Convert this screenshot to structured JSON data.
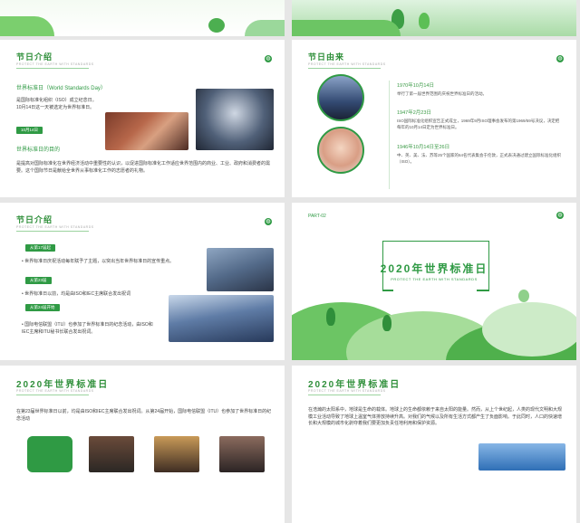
{
  "slides": {
    "intro": {
      "title": "节日介绍",
      "subtitle": "PROTECT THE EARTH WITH STANDARDS",
      "heading": "世界标准日（World Standards Day）",
      "body1": "是国际标准化组织（ISO）成立纪念日。10月14日这一天被选定为世界标准日。",
      "tag": "10月14日",
      "purpose": "世界标准日的目的",
      "body2": "是提高对国际标准化在世界经济活动中重要性的认识，以促进国际标准化工作适应世界范围内的商业、工业、政府和消费者的需要。这个国际节日是献给全世界从事标准化工作的志愿者的礼物。"
    },
    "origin": {
      "title": "节日由来",
      "subtitle": "PROTECT THE EARTH WITH STANDARDS",
      "items": [
        {
          "date": "1970年10月14日",
          "text": "举行了第一届世界范围的庆祝世界标准日的活动。"
        },
        {
          "date": "1947年2月23日",
          "text": "ISO国际标准化组织宣告正式成立，1969年9月ISO理事会发布的第1969/59号决议，决定把每年的10月14日定为世界标准日。"
        },
        {
          "date": "1946年10月14日至26日",
          "text": "中、英、美、法、苏等25个国家的64名代表集会于伦敦，正式表决通过建立国际标准化组织（ISO）。"
        }
      ]
    },
    "intro2": {
      "title": "节日介绍",
      "subtitle": "PROTECT THE EARTH WITH STANDARDS",
      "tag1": "从第17届起",
      "text1": "世界标准日庆祝活动每年赋予了主题，以突出当年世界标准日的宣传重点。",
      "tag2": "从第23届",
      "text2": "世界标准日以前，均是由ISO和IEC主席联合发出祝词",
      "tag3": "从第24届开始",
      "text3": "国际电信联盟（ITU）也参加了世界标准日的纪念活动，由ISO和IEC主席和ITU秘书长联合发出祝词。"
    },
    "part": {
      "label": "PART-02",
      "title": "2020年世界标准日",
      "sub": "PROTECT THE EARTH WITH STANDARDS"
    },
    "event1": {
      "title": "2020年世界标准日",
      "subtitle": "PROTECT THE EARTH WITH STANDARDS",
      "body": "在第23届世界标准日以前，均是由ISO和IEC主席联合发出祝词。从第24届开始，国际电信联盟（ITU）也参加了世界标准日的纪念活动"
    },
    "event2": {
      "title": "2020年世界标准日",
      "subtitle": "PROTECT THE EARTH WITH STANDARDS",
      "body": "在浩瀚的太阳系中，地球是生命的载体。地球上的生命都依赖于来自太阳的能量。然而，从上个世纪起，人类的现代文明和大规模工业活动导致了地球上温室气体排放持续升高。对我们的气候以及所有生活方式都产生了负面影响。于此同时，人口的快速增长和大规模的城市化剥夺着我们要更加负责任地利用和保护资源。"
    }
  }
}
